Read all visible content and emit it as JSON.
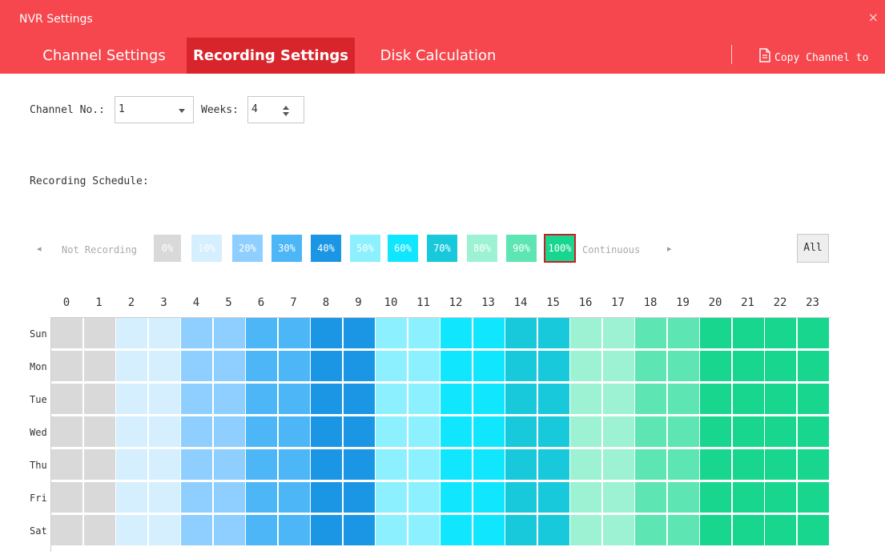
{
  "window": {
    "title": "NVR Settings",
    "close_glyph": "×"
  },
  "tabs": [
    {
      "label": "Channel Settings",
      "active": false
    },
    {
      "label": "Recording Settings",
      "active": true
    },
    {
      "label": "Disk Calculation",
      "active": false
    }
  ],
  "toolbar": {
    "copy_label": "Copy Channel to",
    "copy_icon": "copy-document-icon"
  },
  "form": {
    "channel_label": "Channel No.:",
    "channel_value": "1",
    "weeks_label": "Weeks:",
    "weeks_value": "4"
  },
  "schedule": {
    "label": "Recording Schedule:",
    "legend_left_text": "Not Recording",
    "legend_right_text": "Continuous",
    "all_label": "All",
    "prev_glyph": "◂",
    "next_glyph": "▸",
    "levels": [
      {
        "label": "0%",
        "color": "#d9d9d9"
      },
      {
        "label": "10%",
        "color": "#d5efff"
      },
      {
        "label": "20%",
        "color": "#8ecfff"
      },
      {
        "label": "30%",
        "color": "#4cb6f7"
      },
      {
        "label": "40%",
        "color": "#1a96e4"
      },
      {
        "label": "50%",
        "color": "#8cf0ff"
      },
      {
        "label": "60%",
        "color": "#10e7ff"
      },
      {
        "label": "70%",
        "color": "#18c9dc"
      },
      {
        "label": "80%",
        "color": "#9cf2d2"
      },
      {
        "label": "90%",
        "color": "#5de6b3"
      },
      {
        "label": "100%",
        "color": "#19d68e"
      }
    ],
    "selected_level": "100%",
    "hours": [
      "0",
      "1",
      "2",
      "3",
      "4",
      "5",
      "6",
      "7",
      "8",
      "9",
      "10",
      "11",
      "12",
      "13",
      "14",
      "15",
      "16",
      "17",
      "18",
      "19",
      "20",
      "21",
      "22",
      "23"
    ],
    "days": [
      "Sun",
      "Mon",
      "Tue",
      "Wed",
      "Thu",
      "Fri",
      "Sat"
    ],
    "hour_levels": [
      0,
      0,
      1,
      1,
      2,
      2,
      3,
      3,
      4,
      4,
      5,
      5,
      6,
      6,
      7,
      7,
      8,
      8,
      9,
      9,
      10,
      10,
      10,
      10
    ]
  }
}
